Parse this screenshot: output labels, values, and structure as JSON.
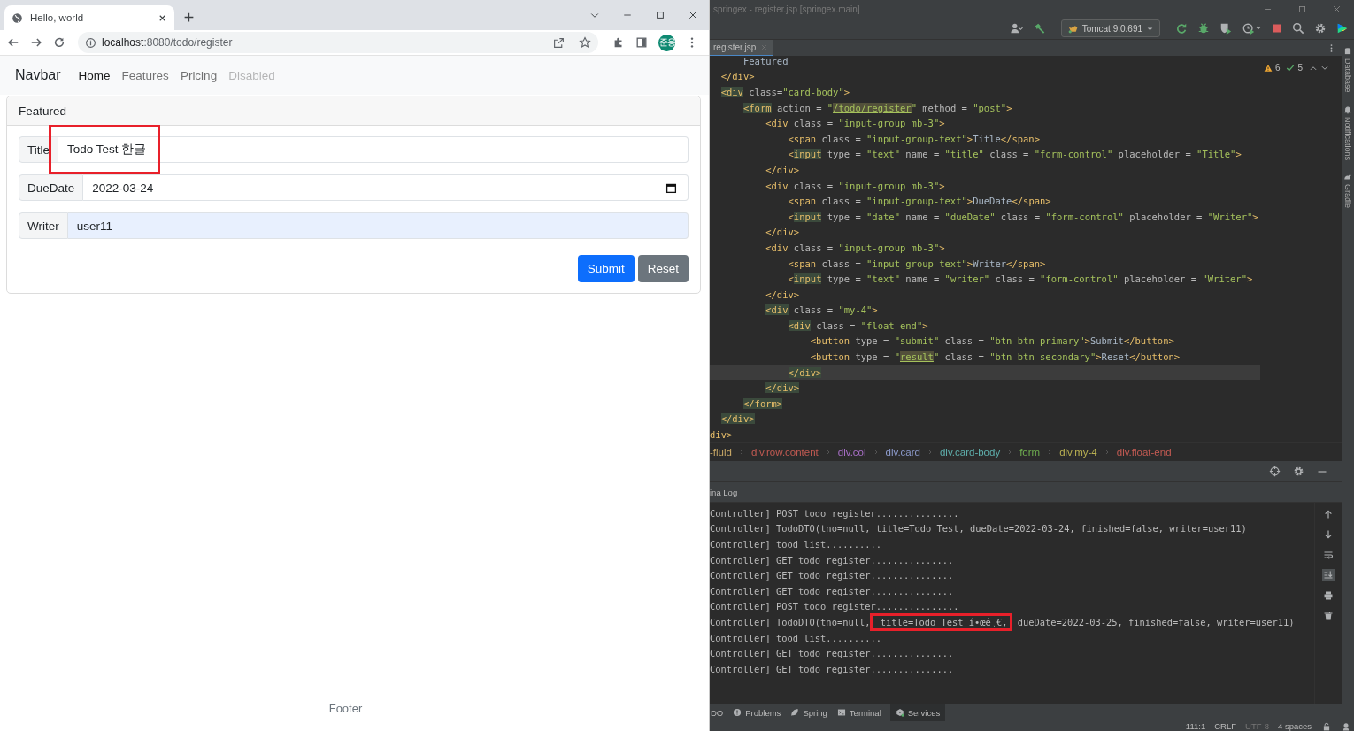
{
  "browser": {
    "tab": {
      "title": "Hello, world"
    },
    "address": {
      "host": "localhost",
      "path": ":8080/todo/register"
    },
    "profile": {
      "initials": "준용"
    },
    "page": {
      "navbar": {
        "brand": "Navbar",
        "links": [
          {
            "label": "Home",
            "selected": true,
            "disabled": false
          },
          {
            "label": "Features",
            "selected": false,
            "disabled": false
          },
          {
            "label": "Pricing",
            "selected": false,
            "disabled": false
          },
          {
            "label": "Disabled",
            "selected": false,
            "disabled": true
          }
        ]
      },
      "card": {
        "header": "Featured",
        "fields": [
          {
            "label": "Title",
            "kind": "text",
            "value": "Todo Test 한글",
            "autofilled": false,
            "annotated": true
          },
          {
            "label": "DueDate",
            "kind": "date",
            "value": "2022-03-24",
            "autofilled": false,
            "annotated": false
          },
          {
            "label": "Writer",
            "kind": "text",
            "value": "user11",
            "autofilled": true,
            "annotated": false
          }
        ],
        "buttons": [
          {
            "label": "Submit",
            "kind": "primary"
          },
          {
            "label": "Reset",
            "kind": "secondary"
          }
        ]
      },
      "footer": "Footer"
    }
  },
  "ide": {
    "window": {
      "title": "springex - register.jsp [springex.main]"
    },
    "run_config": "Tomcat 9.0.691",
    "editor_tabs": [
      {
        "label": "register.jsp",
        "selected": true
      }
    ],
    "inspections": {
      "warnings": "6",
      "weak_warnings": "5"
    },
    "side_tools": [
      "Database",
      "Notifications",
      "Gradle"
    ],
    "code_lines": [
      {
        "current": false,
        "segments": [
          {
            "kind": "text",
            "text": "      Featured"
          }
        ]
      },
      {
        "current": false,
        "segments": [
          {
            "kind": "tag",
            "text": "  </div>"
          }
        ]
      },
      {
        "current": false,
        "segments": [
          {
            "kind": "tag-match",
            "text": "  <div"
          },
          {
            "kind": "attr",
            "text": " class="
          },
          {
            "kind": "str",
            "text": "\"card-body\""
          },
          {
            "kind": "tag",
            "text": ">"
          }
        ]
      },
      {
        "current": false,
        "segments": [
          {
            "kind": "tag-match",
            "text": "      <form"
          },
          {
            "kind": "attr",
            "text": " action = "
          },
          {
            "kind": "str",
            "text": "\""
          },
          {
            "kind": "str-match",
            "text": "/todo/register"
          },
          {
            "kind": "str",
            "text": "\""
          },
          {
            "kind": "attr",
            "text": " method = "
          },
          {
            "kind": "str",
            "text": "\"post\""
          },
          {
            "kind": "tag",
            "text": ">"
          }
        ]
      },
      {
        "current": false,
        "segments": [
          {
            "kind": "tag",
            "text": "          <div"
          },
          {
            "kind": "attr",
            "text": " class = "
          },
          {
            "kind": "str",
            "text": "\"input-group mb-3\""
          },
          {
            "kind": "tag",
            "text": ">"
          }
        ]
      },
      {
        "current": false,
        "segments": [
          {
            "kind": "tag",
            "text": "              <span"
          },
          {
            "kind": "attr",
            "text": " class = "
          },
          {
            "kind": "str",
            "text": "\"input-group-text\""
          },
          {
            "kind": "tag",
            "text": ">"
          },
          {
            "kind": "text",
            "text": "Title"
          },
          {
            "kind": "tag",
            "text": "</span>"
          }
        ]
      },
      {
        "current": false,
        "segments": [
          {
            "kind": "tag",
            "text": "              <"
          },
          {
            "kind": "tag-match",
            "text": "input"
          },
          {
            "kind": "attr",
            "text": " type = "
          },
          {
            "kind": "str",
            "text": "\"text\""
          },
          {
            "kind": "attr",
            "text": " name = "
          },
          {
            "kind": "str",
            "text": "\"title\""
          },
          {
            "kind": "attr",
            "text": " class = "
          },
          {
            "kind": "str",
            "text": "\"form-control\""
          },
          {
            "kind": "attr",
            "text": " placeholder = "
          },
          {
            "kind": "str",
            "text": "\"Title\""
          },
          {
            "kind": "tag",
            "text": ">"
          }
        ]
      },
      {
        "current": false,
        "segments": [
          {
            "kind": "tag",
            "text": "          </div>"
          }
        ]
      },
      {
        "current": false,
        "segments": [
          {
            "kind": "tag",
            "text": "          <div"
          },
          {
            "kind": "attr",
            "text": " class = "
          },
          {
            "kind": "str",
            "text": "\"input-group mb-3\""
          },
          {
            "kind": "tag",
            "text": ">"
          }
        ]
      },
      {
        "current": false,
        "segments": [
          {
            "kind": "tag",
            "text": "              <span"
          },
          {
            "kind": "attr",
            "text": " class = "
          },
          {
            "kind": "str",
            "text": "\"input-group-text\""
          },
          {
            "kind": "tag",
            "text": ">"
          },
          {
            "kind": "text",
            "text": "DueDate"
          },
          {
            "kind": "tag",
            "text": "</span>"
          }
        ]
      },
      {
        "current": false,
        "segments": [
          {
            "kind": "tag",
            "text": "              <"
          },
          {
            "kind": "tag-match",
            "text": "input"
          },
          {
            "kind": "attr",
            "text": " type = "
          },
          {
            "kind": "str",
            "text": "\"date\""
          },
          {
            "kind": "attr",
            "text": " name = "
          },
          {
            "kind": "str",
            "text": "\"dueDate\""
          },
          {
            "kind": "attr",
            "text": " class = "
          },
          {
            "kind": "str",
            "text": "\"form-control\""
          },
          {
            "kind": "attr",
            "text": " placeholder = "
          },
          {
            "kind": "str",
            "text": "\"Writer\""
          },
          {
            "kind": "tag",
            "text": ">"
          }
        ]
      },
      {
        "current": false,
        "segments": [
          {
            "kind": "tag",
            "text": "          </div>"
          }
        ]
      },
      {
        "current": false,
        "segments": [
          {
            "kind": "tag",
            "text": "          <div"
          },
          {
            "kind": "attr",
            "text": " class = "
          },
          {
            "kind": "str",
            "text": "\"input-group mb-3\""
          },
          {
            "kind": "tag",
            "text": ">"
          }
        ]
      },
      {
        "current": false,
        "segments": [
          {
            "kind": "tag",
            "text": "              <span"
          },
          {
            "kind": "attr",
            "text": " class = "
          },
          {
            "kind": "str",
            "text": "\"input-group-text\""
          },
          {
            "kind": "tag",
            "text": ">"
          },
          {
            "kind": "text",
            "text": "Writer"
          },
          {
            "kind": "tag",
            "text": "</span>"
          }
        ]
      },
      {
        "current": false,
        "segments": [
          {
            "kind": "tag",
            "text": "              <"
          },
          {
            "kind": "tag-match",
            "text": "input"
          },
          {
            "kind": "attr",
            "text": " type = "
          },
          {
            "kind": "str",
            "text": "\"text\""
          },
          {
            "kind": "attr",
            "text": " name = "
          },
          {
            "kind": "str",
            "text": "\"writer\""
          },
          {
            "kind": "attr",
            "text": " class = "
          },
          {
            "kind": "str",
            "text": "\"form-control\""
          },
          {
            "kind": "attr",
            "text": " placeholder = "
          },
          {
            "kind": "str",
            "text": "\"Writer\""
          },
          {
            "kind": "tag",
            "text": ">"
          }
        ]
      },
      {
        "current": false,
        "segments": [
          {
            "kind": "tag",
            "text": "          </div>"
          }
        ]
      },
      {
        "current": false,
        "segments": [
          {
            "kind": "tag-match",
            "text": "          <div"
          },
          {
            "kind": "attr",
            "text": " class = "
          },
          {
            "kind": "str",
            "text": "\"my-4\""
          },
          {
            "kind": "tag",
            "text": ">"
          }
        ]
      },
      {
        "current": false,
        "segments": [
          {
            "kind": "tag-match",
            "text": "              <div"
          },
          {
            "kind": "attr",
            "text": " class = "
          },
          {
            "kind": "str",
            "text": "\"float-end\""
          },
          {
            "kind": "tag",
            "text": ">"
          }
        ]
      },
      {
        "current": false,
        "segments": [
          {
            "kind": "tag",
            "text": "                  <button"
          },
          {
            "kind": "attr",
            "text": " type = "
          },
          {
            "kind": "str",
            "text": "\"submit\""
          },
          {
            "kind": "attr",
            "text": " class = "
          },
          {
            "kind": "str",
            "text": "\"btn btn-primary\""
          },
          {
            "kind": "tag",
            "text": ">"
          },
          {
            "kind": "text",
            "text": "Submit"
          },
          {
            "kind": "tag",
            "text": "</button>"
          }
        ]
      },
      {
        "current": false,
        "segments": [
          {
            "kind": "tag",
            "text": "                  <button"
          },
          {
            "kind": "attr",
            "text": " type = "
          },
          {
            "kind": "str",
            "text": "\""
          },
          {
            "kind": "str-match",
            "text": "result"
          },
          {
            "kind": "str",
            "text": "\""
          },
          {
            "kind": "attr",
            "text": " class = "
          },
          {
            "kind": "str",
            "text": "\"btn btn-secondary\""
          },
          {
            "kind": "tag",
            "text": ">"
          },
          {
            "kind": "text",
            "text": "Reset"
          },
          {
            "kind": "tag",
            "text": "</button>"
          }
        ]
      },
      {
        "current": true,
        "segments": [
          {
            "kind": "tag-match",
            "text": "              </div>"
          }
        ]
      },
      {
        "current": false,
        "segments": [
          {
            "kind": "tag-match",
            "text": "          </div>"
          }
        ]
      },
      {
        "current": false,
        "segments": [
          {
            "kind": "tag-match",
            "text": "      </form>"
          }
        ]
      },
      {
        "current": false,
        "segments": [
          {
            "kind": "tag-match",
            "text": "  </div>"
          }
        ]
      },
      {
        "current": false,
        "segments": [
          {
            "kind": "tag",
            "text": "div>"
          }
        ]
      }
    ],
    "breadcrumbs": [
      {
        "label": "-fluid",
        "color": "#c9a866"
      },
      {
        "label": "div.row.content",
        "color": "#c25a52"
      },
      {
        "label": "div.col",
        "color": "#a86fc7"
      },
      {
        "label": "div.card",
        "color": "#8c9acb"
      },
      {
        "label": "div.card-body",
        "color": "#5fb0ad"
      },
      {
        "label": "form",
        "color": "#6fae50"
      },
      {
        "label": "div.my-4",
        "color": "#b9b052"
      },
      {
        "label": "div.float-end",
        "color": "#c25a52"
      }
    ],
    "run_panel": {
      "tab": "ina Log",
      "lines": [
        {
          "segments": [
            {
              "text": "Controller] POST todo register...............",
              "annotated": false
            }
          ]
        },
        {
          "segments": [
            {
              "text": "Controller] TodoDTO(tno=null, title=Todo Test, dueDate=2022-03-24, finished=false, writer=user11)",
              "annotated": false
            }
          ]
        },
        {
          "segments": [
            {
              "text": "Controller] tood list..........",
              "annotated": false
            }
          ]
        },
        {
          "segments": [
            {
              "text": "Controller] GET todo register...............",
              "annotated": false
            }
          ]
        },
        {
          "segments": [
            {
              "text": "Controller] GET todo register...............",
              "annotated": false
            }
          ]
        },
        {
          "segments": [
            {
              "text": "Controller] GET todo register...............",
              "annotated": false
            }
          ]
        },
        {
          "segments": [
            {
              "text": "Controller] POST todo register...............",
              "annotated": false
            }
          ]
        },
        {
          "segments": [
            {
              "text": "Controller] TodoDTO(tno=null,",
              "annotated": false
            },
            {
              "text": " title=Todo Test í•œê¸€,",
              "annotated": true
            },
            {
              "text": " dueDate=2022-03-25, finished=false, writer=user11)",
              "annotated": false
            }
          ]
        },
        {
          "segments": [
            {
              "text": "Controller] tood list..........",
              "annotated": false
            }
          ]
        },
        {
          "segments": [
            {
              "text": "Controller] GET todo register...............",
              "annotated": false
            }
          ]
        },
        {
          "segments": [
            {
              "text": "Controller] GET todo register...............",
              "annotated": false
            }
          ]
        }
      ]
    },
    "tool_tabs": [
      {
        "label": "DO",
        "selected": false
      },
      {
        "label": "Problems",
        "selected": false
      },
      {
        "label": "Spring",
        "selected": false
      },
      {
        "label": "Terminal",
        "selected": false
      },
      {
        "label": "Services",
        "selected": true
      }
    ],
    "status": [
      "111:1",
      "CRLF",
      "UTF-8",
      "4 spaces"
    ]
  }
}
